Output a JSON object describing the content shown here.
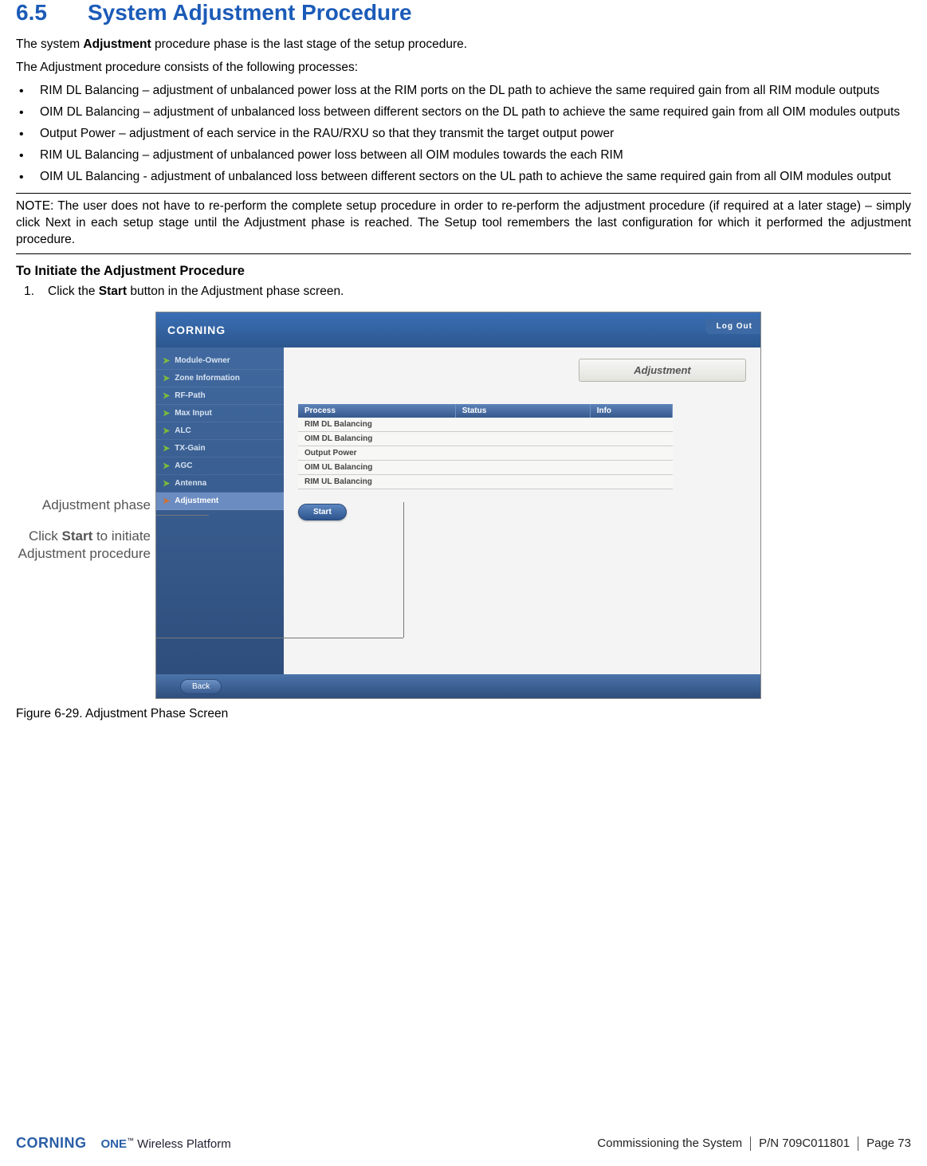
{
  "heading": {
    "number": "6.5",
    "title": "System Adjustment Procedure"
  },
  "intro1_pre": "The system ",
  "intro1_bold": "Adjustment",
  "intro1_post": " procedure phase is the last stage of the setup procedure.",
  "intro2": "The Adjustment procedure consists of the following processes:",
  "bullets": [
    "RIM DL Balancing – adjustment of unbalanced power loss at the RIM ports on the DL path to achieve the same required gain from all RIM module outputs",
    "OIM DL Balancing – adjustment of unbalanced loss between different sectors on the DL path to achieve the same required gain from all OIM modules outputs",
    "Output Power – adjustment of each service in the RAU/RXU so that they transmit the target output power",
    "RIM UL Balancing –   adjustment of unbalanced power loss between all OIM modules towards the each RIM",
    "OIM UL Balancing - adjustment of unbalanced loss between different sectors on the UL path to achieve the same required gain from all OIM modules output"
  ],
  "note": "NOTE: The user does not have to re-perform the complete setup procedure in order to re-perform the adjustment procedure (if required at a later stage) – simply click Next in each setup stage until the Adjustment phase is reached. The Setup tool remembers the last configuration for which it performed the adjustment procedure.",
  "subheading": "To Initiate the Adjustment Procedure",
  "step1_pre": "Click the ",
  "step1_bold": "Start",
  "step1_post": " button in the Adjustment phase screen.",
  "annotations": {
    "phase": "Adjustment phase",
    "start_pre": "Click ",
    "start_bold": "Start",
    "start_post": " to initiate Adjustment procedure"
  },
  "screenshot": {
    "brand": "CORNING",
    "logout": "Log Out",
    "sidebar": {
      "items": [
        {
          "label": "Module-Owner"
        },
        {
          "label": "Zone Information"
        },
        {
          "label": "RF-Path"
        },
        {
          "label": "Max Input"
        },
        {
          "label": "ALC"
        },
        {
          "label": "TX-Gain"
        },
        {
          "label": "AGC"
        },
        {
          "label": "Antenna"
        },
        {
          "label": "Adjustment"
        }
      ]
    },
    "content_title": "Adjustment",
    "table": {
      "headers": [
        "Process",
        "Status",
        "Info"
      ],
      "rows": [
        "RIM DL Balancing",
        "OIM DL Balancing",
        "Output Power",
        "OIM UL Balancing",
        "RIM UL Balancing"
      ]
    },
    "start_button": "Start",
    "back_button": "Back"
  },
  "figure_caption": "Figure 6-29. Adjustment Phase Screen",
  "footer": {
    "corning": "CORNING",
    "one": "ONE",
    "one_suffix": " Wireless Platform",
    "section": "Commissioning the System",
    "pn": "P/N 709C011801",
    "page": "Page 73"
  }
}
